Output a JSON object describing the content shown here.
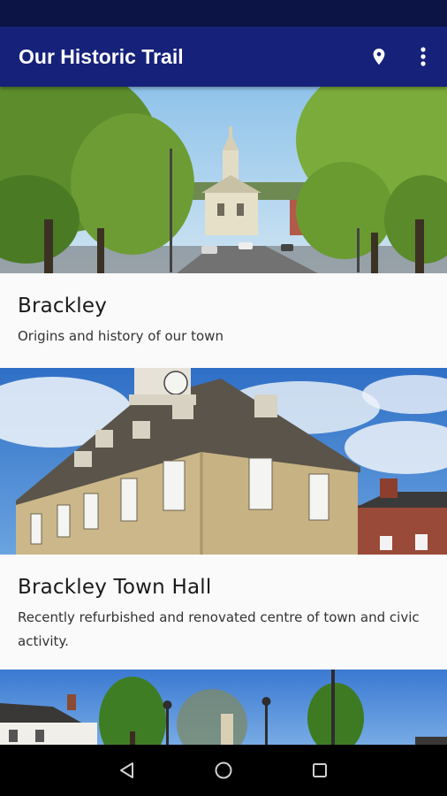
{
  "app": {
    "title": "Our Historic Trail",
    "icons": {
      "location": "location-pin-icon",
      "menu": "more-vert-icon"
    },
    "colors": {
      "appbar": "#16217a",
      "statusbar": "#0b1444"
    }
  },
  "cards": [
    {
      "title": "Brackley",
      "description": "Origins and history of our town",
      "image": "brackley-street-photo"
    },
    {
      "title": "Brackley Town Hall",
      "description": "Recently refurbished and renovated centre of town and civic activity.",
      "image": "town-hall-photo"
    },
    {
      "title": "",
      "description": "",
      "image": "street-lamps-photo"
    }
  ],
  "navbar": {
    "icons": [
      "back-icon",
      "home-icon",
      "recents-icon"
    ]
  }
}
